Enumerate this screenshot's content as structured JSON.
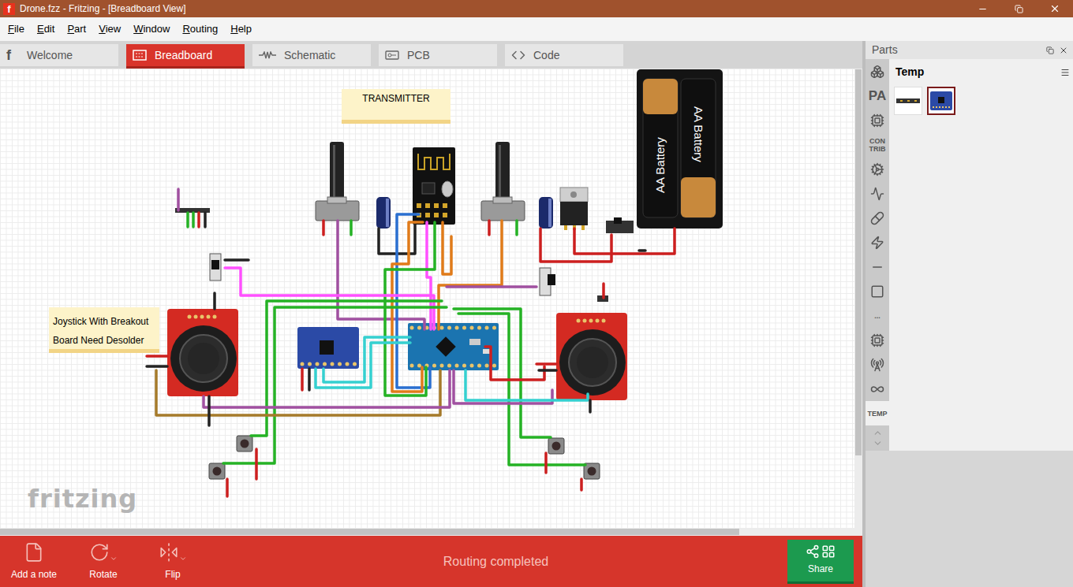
{
  "window": {
    "title": "Drone.fzz - Fritzing - [Breadboard View]",
    "logo": "f"
  },
  "menu": [
    "File",
    "Edit",
    "Part",
    "View",
    "Window",
    "Routing",
    "Help"
  ],
  "tabs": [
    {
      "label": "Welcome",
      "selected": false
    },
    {
      "label": "Breadboard",
      "selected": true
    },
    {
      "label": "Schematic",
      "selected": false
    },
    {
      "label": "PCB",
      "selected": false
    },
    {
      "label": "Code",
      "selected": false
    }
  ],
  "canvas": {
    "notes": [
      {
        "text": "TRANSMITTER"
      },
      {
        "text": "Joystick With Breakout Board Need Desolder"
      }
    ],
    "battery_labels": [
      "AA Battery",
      "AA Battery"
    ],
    "watermark": "fritzing"
  },
  "toolbar": {
    "buttons": [
      {
        "label": "Add a note",
        "dropdown": false
      },
      {
        "label": "Rotate",
        "dropdown": true
      },
      {
        "label": "Flip",
        "dropdown": true
      }
    ],
    "status": "Routing completed",
    "share": "Share"
  },
  "parts_panel": {
    "title": "Parts",
    "bins": [
      {
        "kind": "icon",
        "selected": false
      },
      {
        "kind": "text",
        "label": "PA",
        "selected": false
      },
      {
        "kind": "icon",
        "selected": false
      },
      {
        "kind": "text",
        "label": "CON TRIB",
        "selected": false
      },
      {
        "kind": "icon",
        "selected": false
      },
      {
        "kind": "icon",
        "selected": false
      },
      {
        "kind": "icon",
        "selected": false
      },
      {
        "kind": "icon",
        "selected": false
      },
      {
        "kind": "icon",
        "selected": false
      },
      {
        "kind": "icon",
        "selected": false
      },
      {
        "kind": "text",
        "label": "...",
        "selected": false
      },
      {
        "kind": "icon",
        "selected": false
      },
      {
        "kind": "icon",
        "selected": false
      },
      {
        "kind": "icon",
        "selected": false
      },
      {
        "kind": "text",
        "label": "TEMP",
        "selected": true
      }
    ],
    "bin_title": "Temp",
    "parts": [
      {
        "selected": false
      },
      {
        "selected": true
      }
    ]
  }
}
